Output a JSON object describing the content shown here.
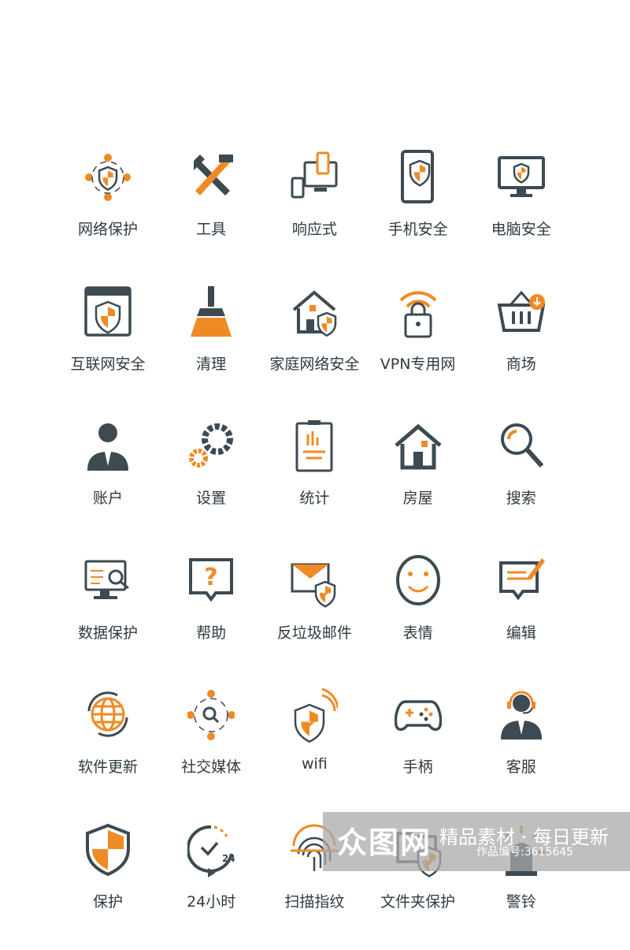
{
  "colors": {
    "accent": "#f08a24",
    "dark": "#3d4a52",
    "text": "#2f3a40"
  },
  "icons": [
    {
      "label": "网络保护",
      "icon": "network-shield"
    },
    {
      "label": "工具",
      "icon": "tools"
    },
    {
      "label": "响应式",
      "icon": "responsive-devices"
    },
    {
      "label": "手机安全",
      "icon": "phone-shield"
    },
    {
      "label": "电脑安全",
      "icon": "monitor-shield"
    },
    {
      "label": "互联网安全",
      "icon": "browser-shield"
    },
    {
      "label": "清理",
      "icon": "broom"
    },
    {
      "label": "家庭网络安全",
      "icon": "home-shield"
    },
    {
      "label": "VPN专用网",
      "icon": "vpn-lock"
    },
    {
      "label": "商场",
      "icon": "basket"
    },
    {
      "label": "账户",
      "icon": "user"
    },
    {
      "label": "设置",
      "icon": "gears"
    },
    {
      "label": "统计",
      "icon": "clipboard-chart"
    },
    {
      "label": "房屋",
      "icon": "house"
    },
    {
      "label": "搜索",
      "icon": "magnifier"
    },
    {
      "label": "数据保护",
      "icon": "monitor-search"
    },
    {
      "label": "帮助",
      "icon": "help-bubble"
    },
    {
      "label": "反垃圾邮件",
      "icon": "mail-shield"
    },
    {
      "label": "表情",
      "icon": "smiley"
    },
    {
      "label": "编辑",
      "icon": "edit-bubble"
    },
    {
      "label": "软件更新",
      "icon": "globe-refresh"
    },
    {
      "label": "社交媒体",
      "icon": "social-search"
    },
    {
      "label": "wifi",
      "icon": "wifi-shield"
    },
    {
      "label": "手柄",
      "icon": "gamepad"
    },
    {
      "label": "客服",
      "icon": "headset-agent"
    },
    {
      "label": "保护",
      "icon": "shield"
    },
    {
      "label": "24小时",
      "icon": "clock-24h"
    },
    {
      "label": "扫描指纹",
      "icon": "fingerprint"
    },
    {
      "label": "文件夹保护",
      "icon": "folder-shield"
    },
    {
      "label": "警铃",
      "icon": "alarm-light"
    }
  ],
  "watermark": {
    "logo": "众图网",
    "slogan": "精品素材 · 每日更新",
    "code": "作品编号:3615645"
  }
}
